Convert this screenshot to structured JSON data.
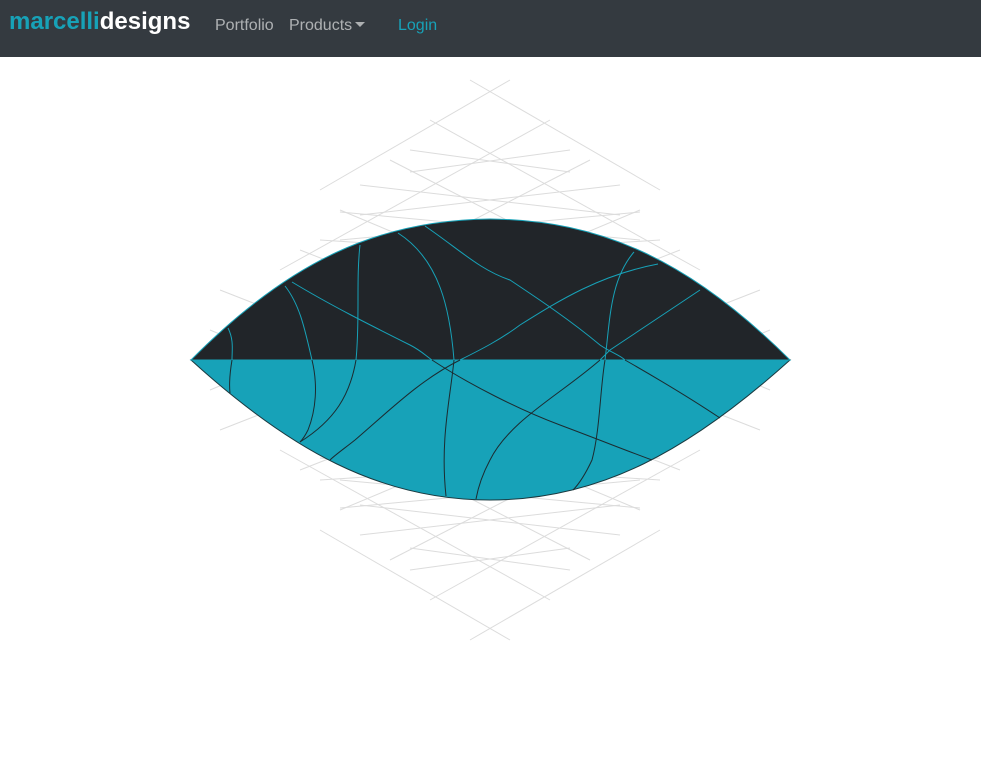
{
  "navbar": {
    "brand_part1": "marcelli",
    "brand_part2": "designs",
    "links": {
      "portfolio": "Portfolio",
      "products": "Products",
      "login": "Login"
    },
    "icons": {
      "products_dropdown": "caret-down-icon"
    }
  },
  "colors": {
    "navbar_bg": "#343a40",
    "accent": "#17a2b8",
    "dark_fill": "#212529",
    "page_bg": "#ffffff",
    "grid_lines": "#dddddd"
  }
}
